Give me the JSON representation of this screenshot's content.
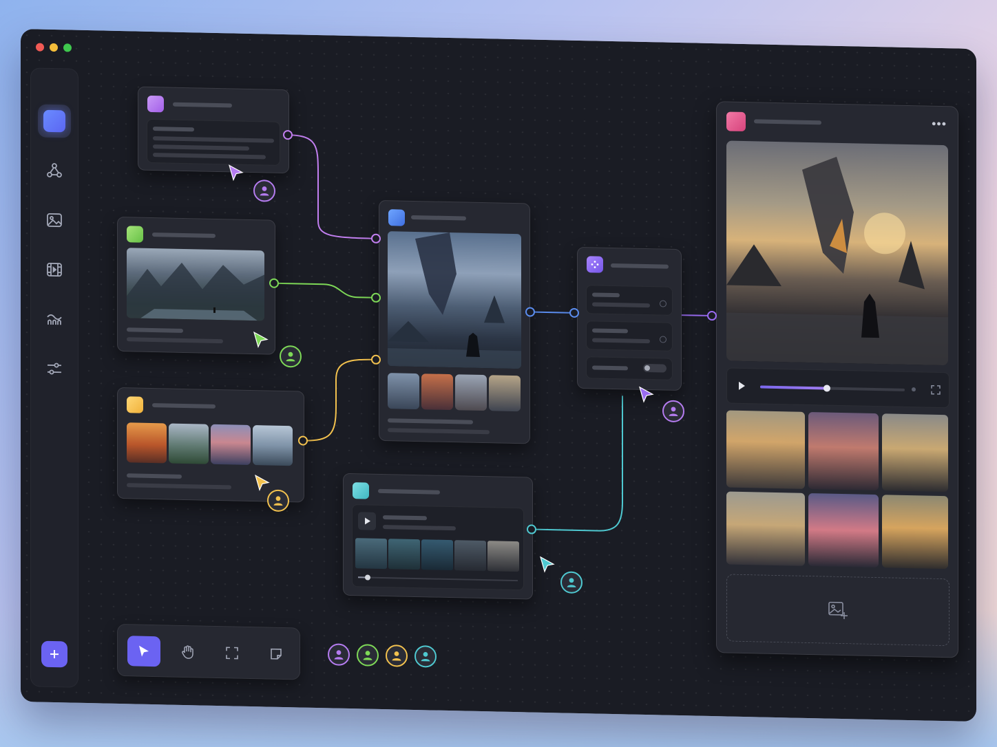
{
  "window": {
    "traffic_lights": [
      "close",
      "minimize",
      "zoom"
    ]
  },
  "colors": {
    "canvas": "#1a1c24",
    "accent": "#6b63f2",
    "node_text_prompt": "#b06cf2",
    "node_landscape": "#7ed957",
    "node_style_refs": "#f2c14e",
    "node_compose": "#5b8def",
    "node_settings": "#8a6cf2",
    "node_video": "#4fc9d1",
    "node_output": "#e8558f"
  },
  "sidebar": {
    "items": [
      {
        "icon": "canvas-icon",
        "active": true
      },
      {
        "icon": "nodes-graph-icon",
        "active": false
      },
      {
        "icon": "image-icon",
        "active": false
      },
      {
        "icon": "film-icon",
        "active": false
      },
      {
        "icon": "waves-icon",
        "active": false
      },
      {
        "icon": "sliders-icon",
        "active": false
      }
    ],
    "add_icon": "plus-icon"
  },
  "toolbar": {
    "tools": [
      {
        "icon": "pointer-icon",
        "active": true
      },
      {
        "icon": "hand-icon",
        "active": false
      },
      {
        "icon": "frame-icon",
        "active": false
      },
      {
        "icon": "sticky-note-icon",
        "active": false
      }
    ]
  },
  "collaborators": [
    {
      "color": "#b57cf0",
      "icon": "user-icon"
    },
    {
      "color": "#7ed957",
      "icon": "user-icon"
    },
    {
      "color": "#f2c14e",
      "icon": "user-icon"
    },
    {
      "color": "#4fc9d1",
      "icon": "user-icon"
    }
  ],
  "video_node": {
    "play_icon": "play-icon",
    "scrub_progress": 0.06
  },
  "settings_node": {
    "toggle_icon": "toggle-icon"
  },
  "output_panel": {
    "menu_icon": "more-icon",
    "play_icon": "play-icon",
    "progress": 0.46,
    "fullscreen_icon": "fullscreen-icon",
    "add_image_icon": "add-image-icon"
  }
}
